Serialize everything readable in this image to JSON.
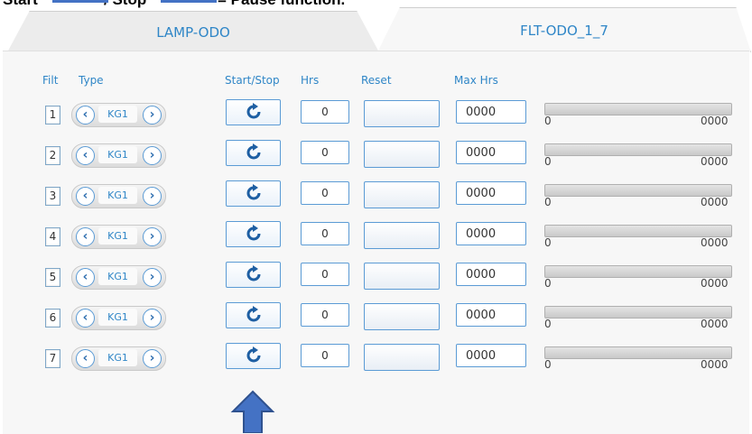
{
  "caption": {
    "word1": "Start",
    "word2": "/ Stop",
    "word3": "= Pause function."
  },
  "tabs": [
    {
      "label": "LAMP-ODO",
      "active": false
    },
    {
      "label": "FLT-ODO_1_7",
      "active": true
    }
  ],
  "headers": {
    "filt": "Filt",
    "type": "Type",
    "start_stop": "Start/Stop",
    "hrs": "Hrs",
    "reset": "Reset",
    "max_hrs": "Max Hrs"
  },
  "rows": [
    {
      "filt": "1",
      "type": "KG1",
      "hrs": "0",
      "reset": "",
      "max_hrs": "0000",
      "bar_min": "0",
      "bar_max": "0000",
      "progress": 0
    },
    {
      "filt": "2",
      "type": "KG1",
      "hrs": "0",
      "reset": "",
      "max_hrs": "0000",
      "bar_min": "0",
      "bar_max": "0000",
      "progress": 0
    },
    {
      "filt": "3",
      "type": "KG1",
      "hrs": "0",
      "reset": "",
      "max_hrs": "0000",
      "bar_min": "0",
      "bar_max": "0000",
      "progress": 0
    },
    {
      "filt": "4",
      "type": "KG1",
      "hrs": "0",
      "reset": "",
      "max_hrs": "0000",
      "bar_min": "0",
      "bar_max": "0000",
      "progress": 0
    },
    {
      "filt": "5",
      "type": "KG1",
      "hrs": "0",
      "reset": "",
      "max_hrs": "0000",
      "bar_min": "0",
      "bar_max": "0000",
      "progress": 0
    },
    {
      "filt": "6",
      "type": "KG1",
      "hrs": "0",
      "reset": "",
      "max_hrs": "0000",
      "bar_min": "0",
      "bar_max": "0000",
      "progress": 0
    },
    {
      "filt": "7",
      "type": "KG1",
      "hrs": "0",
      "reset": "",
      "max_hrs": "0000",
      "bar_min": "0",
      "bar_max": "0000",
      "progress": 0
    }
  ],
  "icons": {
    "arrow_left": "‹",
    "arrow_right": "›",
    "start_stop": "refresh-icon",
    "pointer": "up-arrow-icon"
  },
  "colors": {
    "accent": "#2f86c7",
    "border": "#5b9bd5",
    "pointer": "#4472c4"
  }
}
